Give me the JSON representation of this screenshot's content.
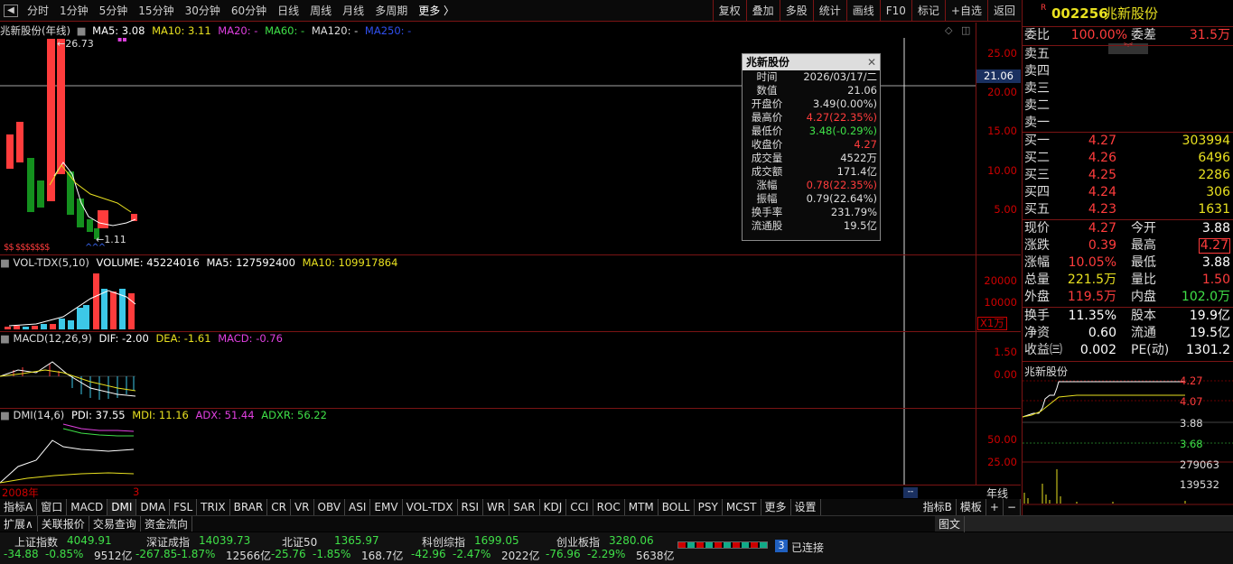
{
  "periods": [
    "分时",
    "1分钟",
    "5分钟",
    "15分钟",
    "30分钟",
    "60分钟",
    "日线",
    "周线",
    "月线",
    "多周期",
    "更多 〉"
  ],
  "toolbar": [
    "复权",
    "叠加",
    "多股",
    "统计",
    "画线",
    "F10",
    "标记",
    "+自选",
    "返回"
  ],
  "main": {
    "title": "兆新股份(年线)",
    "ma5": "MA5: 3.08",
    "ma10": "MA10: 3.11",
    "ma20": "MA20: -",
    "ma60": "MA60: -",
    "ma120": "MA120: -",
    "ma250": "MA250: -",
    "high_mark": "26.73",
    "low_mark": "1.11",
    "crosshair": "21.06",
    "yaxis": [
      "25.00",
      "20.00",
      "15.00",
      "10.00",
      "5.00"
    ]
  },
  "vol": {
    "title": "VOL-TDX(5,10)",
    "v": "VOLUME: 45224016",
    "ma5": "MA5: 127592400",
    "ma10": "MA10: 109917864",
    "yaxis": [
      "20000",
      "10000"
    ],
    "unit": "X1万"
  },
  "macd": {
    "title": "MACD(12,26,9)",
    "dif": "DIF: -2.00",
    "dea": "DEA: -1.61",
    "macd": "MACD: -0.76",
    "yaxis": [
      "1.50",
      "0.00"
    ]
  },
  "dmi": {
    "title": "DMI(14,6)",
    "pdi": "PDI: 37.55",
    "mdi": "MDI: 11.16",
    "adx": "ADX: 51.44",
    "adxr": "ADXR: 56.22",
    "yaxis": [
      "50.00",
      "25.00"
    ]
  },
  "xaxis": {
    "start": "2008年",
    "mid": "3",
    "period": "年线"
  },
  "popup": {
    "title": "兆新股份",
    "rows": [
      [
        "时间",
        "2026/03/17/二"
      ],
      [
        "数值",
        "21.06"
      ],
      [
        "开盘价",
        "3.49(0.00%)"
      ],
      [
        "最高价",
        "4.27(22.35%)"
      ],
      [
        "最低价",
        "3.48(-0.29%)"
      ],
      [
        "收盘价",
        "4.27"
      ],
      [
        "成交量",
        "4522万"
      ],
      [
        "成交额",
        "171.4亿"
      ],
      [
        "涨幅",
        "0.78(22.35%)"
      ],
      [
        "振幅",
        "0.79(22.64%)"
      ],
      [
        "换手率",
        "231.79%"
      ],
      [
        "流通股",
        "19.5亿"
      ]
    ]
  },
  "bottom_tabs": [
    "指标A",
    "窗口",
    "MACD",
    "DMI",
    "DMA",
    "FSL",
    "TRIX",
    "BRAR",
    "CR",
    "VR",
    "OBV",
    "ASI",
    "EMV",
    "VOL-TDX",
    "RSI",
    "WR",
    "SAR",
    "KDJ",
    "CCI",
    "ROC",
    "MTM",
    "BOLL",
    "PSY",
    "MCST",
    "更多",
    "设置"
  ],
  "bottom_right": [
    "指标B",
    "模板",
    "+",
    "−"
  ],
  "func_bar": [
    "扩展∧",
    "关联报价",
    "交易查询",
    "资金流向"
  ],
  "func_right": "图文",
  "indices": [
    {
      "name": "上证指数",
      "value": "4049.91",
      "chg": "-34.88",
      "pct": "-0.85%",
      "amt": "9512亿"
    },
    {
      "name": "深证成指",
      "value": "14039.73",
      "chg": "-267.85",
      "pct": "-1.87%",
      "amt": "12566亿"
    },
    {
      "name": "北证50",
      "value": "1365.97",
      "chg": "-25.76",
      "pct": "-1.85%",
      "amt": "168.7亿"
    },
    {
      "name": "科创综指",
      "value": "1699.05",
      "chg": "-42.96",
      "pct": "-2.47%",
      "amt": "2022亿"
    },
    {
      "name": "创业板指",
      "value": "3280.06",
      "chg": "-76.96",
      "pct": "-2.29%",
      "amt": "5638亿"
    }
  ],
  "conn": {
    "num": "3",
    "text": "已连接"
  },
  "quote": {
    "badge": "R",
    "code": "002256",
    "name": "兆新股份",
    "weibi_label": "委比",
    "weibi": "100.00%",
    "weicha_label": "委差",
    "weicha": "31.5万",
    "sells": [
      [
        "卖五",
        "",
        ""
      ],
      [
        "卖四",
        "",
        ""
      ],
      [
        "卖三",
        "",
        ""
      ],
      [
        "卖二",
        "",
        ""
      ],
      [
        "卖一",
        "",
        ""
      ]
    ],
    "buys": [
      [
        "买一",
        "4.27",
        "303994"
      ],
      [
        "买二",
        "4.26",
        "6496"
      ],
      [
        "买三",
        "4.25",
        "2286"
      ],
      [
        "买四",
        "4.24",
        "306"
      ],
      [
        "买五",
        "4.23",
        "1631"
      ]
    ],
    "stats": [
      [
        "现价",
        "4.27",
        "今开",
        "3.88"
      ],
      [
        "涨跌",
        "0.39",
        "最高",
        "4.27"
      ],
      [
        "涨幅",
        "10.05%",
        "最低",
        "3.88"
      ],
      [
        "总量",
        "221.5万",
        "量比",
        "1.50"
      ],
      [
        "外盘",
        "119.5万",
        "内盘",
        "102.0万"
      ]
    ],
    "stats2": [
      [
        "换手",
        "11.35%",
        "股本",
        "19.9亿"
      ],
      [
        "净资",
        "0.60",
        "流通",
        "19.5亿"
      ],
      [
        "收益㈢",
        "0.002",
        "PE(动)",
        "1301.2"
      ]
    ],
    "mini_title": "兆新股份",
    "mini_y": [
      "4.27",
      "4.07",
      "3.88",
      "3.68"
    ],
    "mini_vol": [
      "279063",
      "139532"
    ]
  }
}
